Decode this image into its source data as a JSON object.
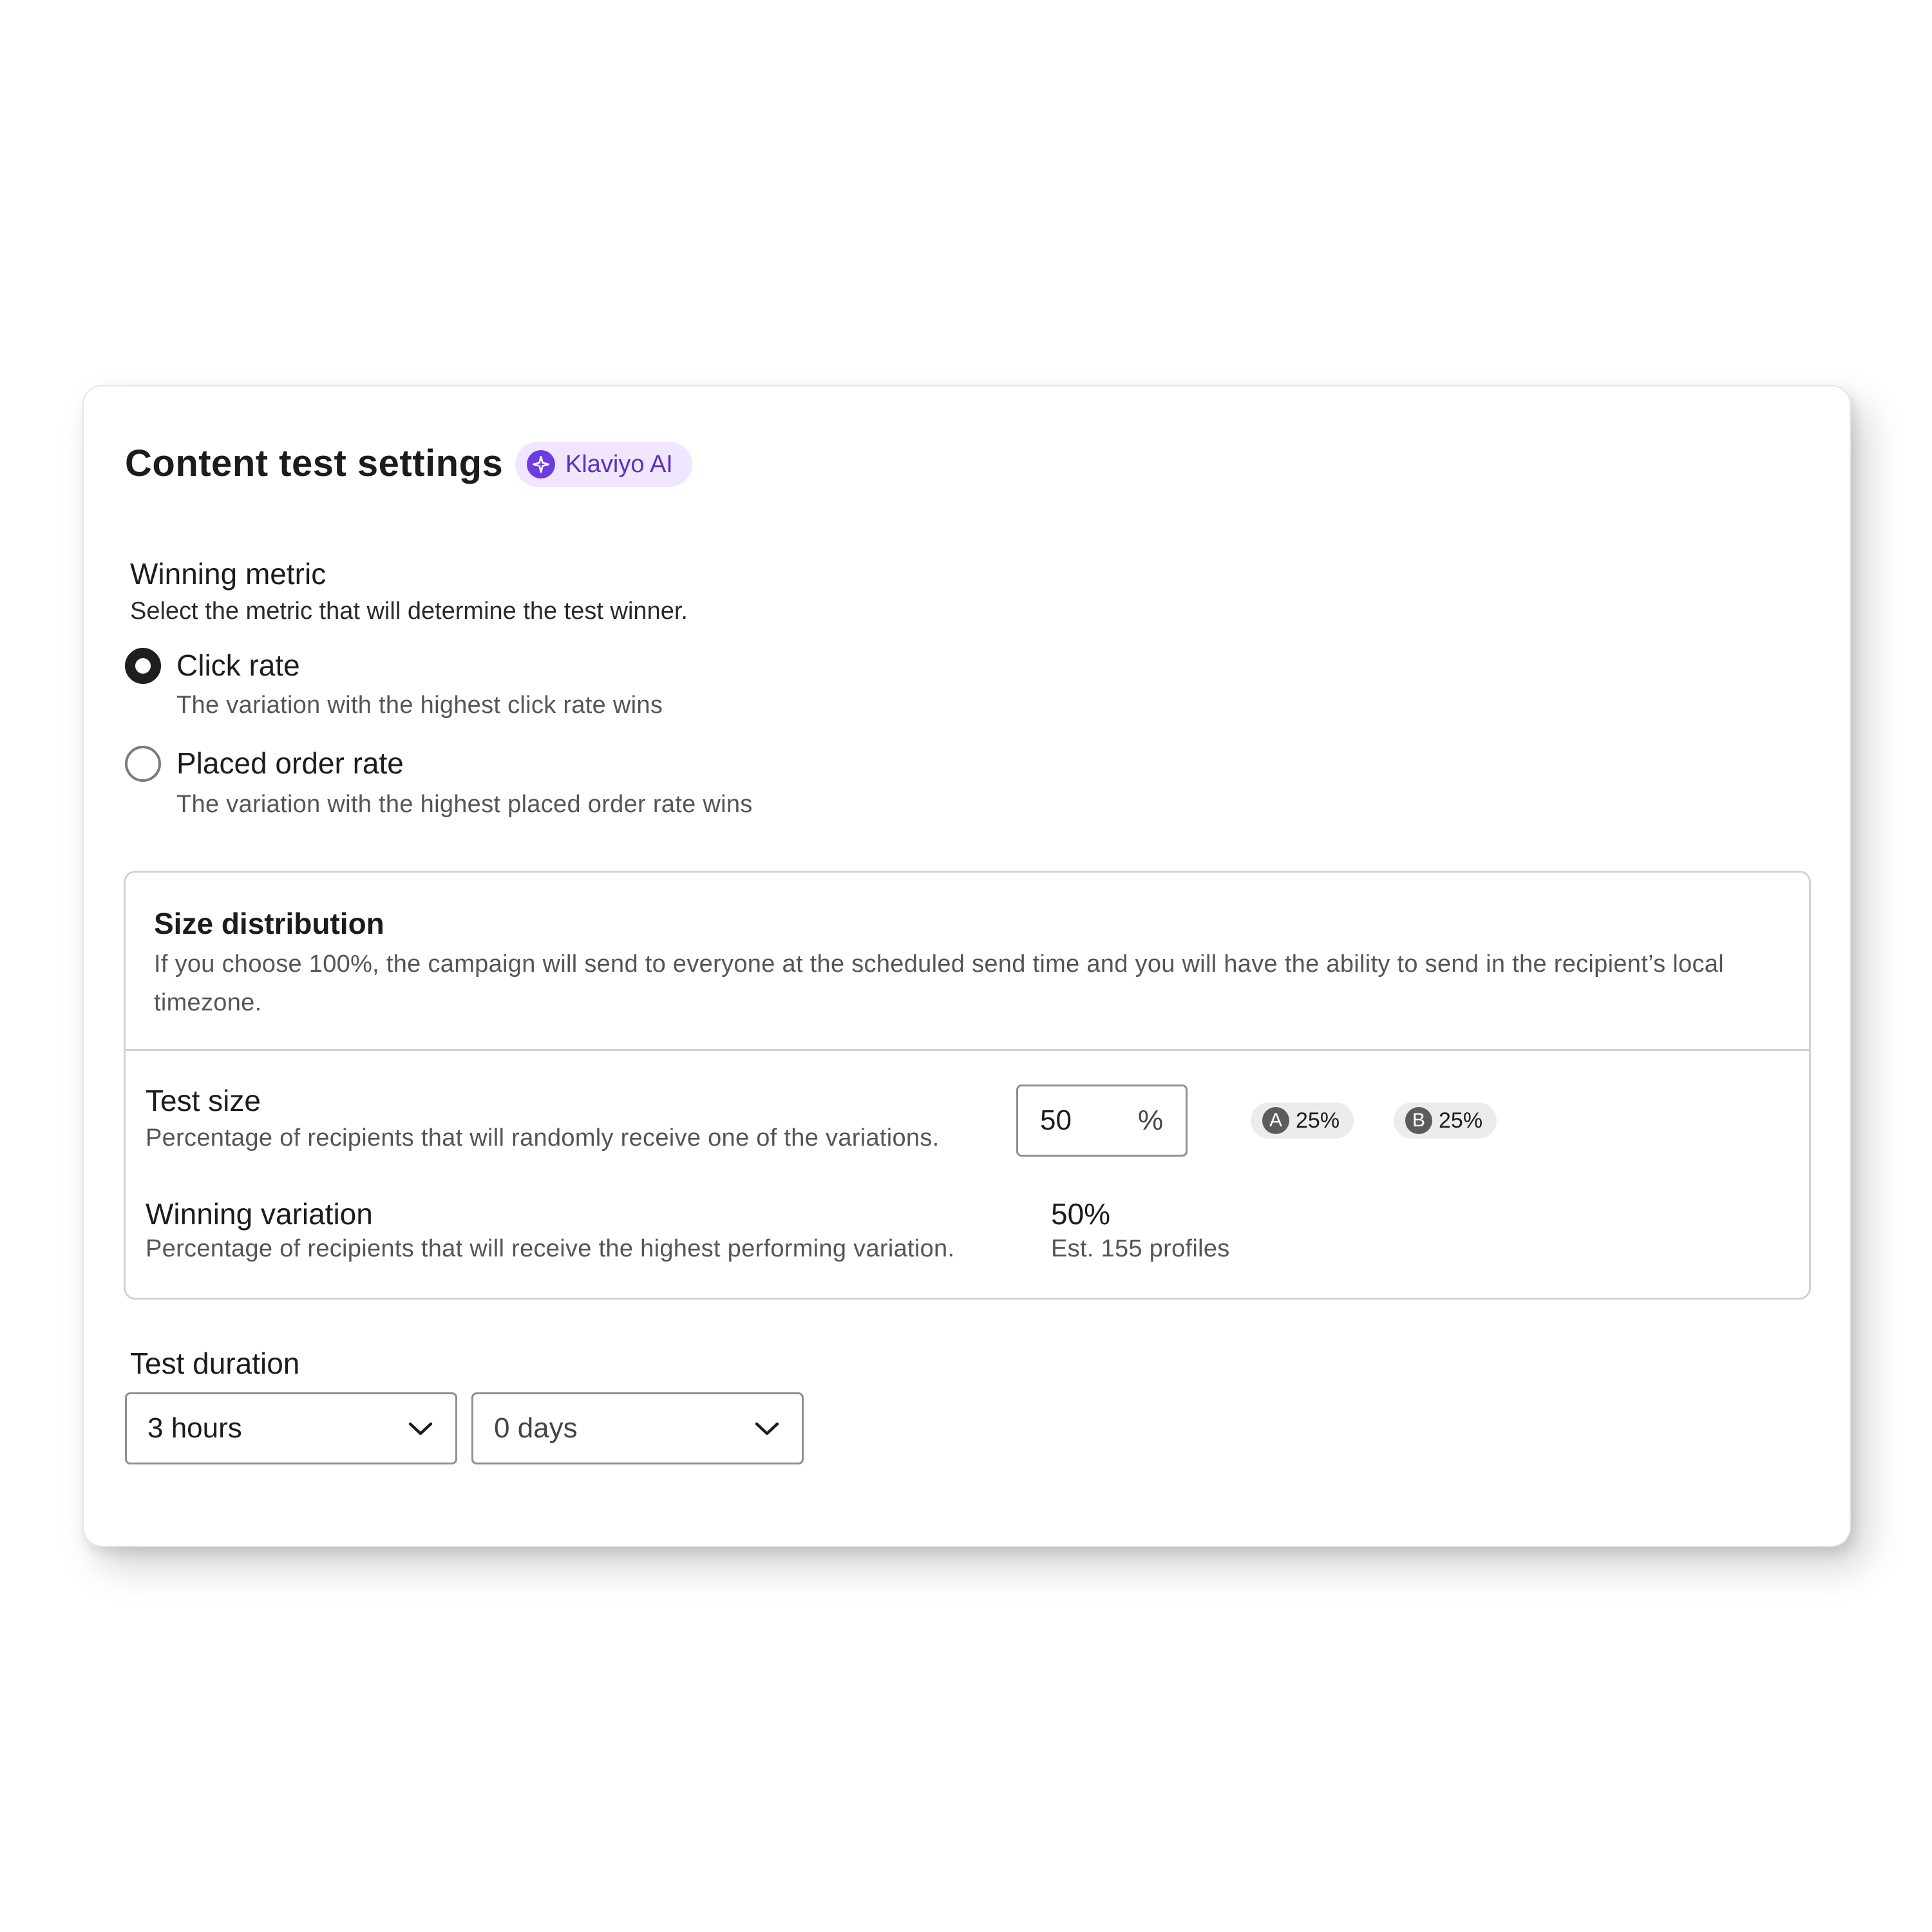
{
  "header": {
    "title": "Content test settings",
    "badge": {
      "icon": "sparkle-icon",
      "label": "Klaviyo AI"
    }
  },
  "winning_metric": {
    "title": "Winning metric",
    "subtitle": "Select the metric that will determine the test winner.",
    "options": [
      {
        "label": "Click rate",
        "description": "The variation with the highest click rate wins",
        "selected": true
      },
      {
        "label": "Placed order rate",
        "description": "The variation with the highest placed order rate wins",
        "selected": false
      }
    ]
  },
  "size_distribution": {
    "title": "Size distribution",
    "description": "If you choose 100%, the campaign will send to everyone at the scheduled send time and you will have the ability to send in the recipient’s local timezone.",
    "test_size": {
      "label": "Test size",
      "description": "Percentage of recipients that will randomly receive one of the variations.",
      "value": "50",
      "unit": "%",
      "split": [
        {
          "letter": "A",
          "value": "25%"
        },
        {
          "letter": "B",
          "value": "25%"
        }
      ]
    },
    "winning_variation": {
      "label": "Winning variation",
      "description": "Percentage of recipients that will receive the highest performing variation.",
      "value": "50%",
      "estimate": "Est. 155 profiles"
    }
  },
  "test_duration": {
    "title": "Test duration",
    "hours": "3 hours",
    "days": "0 days"
  },
  "colors": {
    "accent_purple": "#6c3ce0",
    "badge_bg": "#f1e6ff",
    "text_primary": "#1c1c1c"
  }
}
